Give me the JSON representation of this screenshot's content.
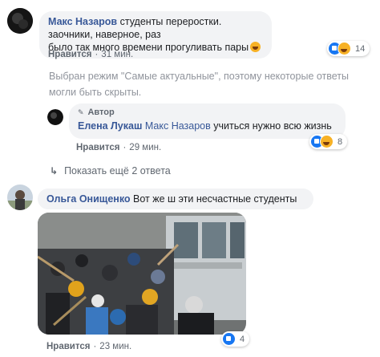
{
  "comments": [
    {
      "author": "Макс Назаров",
      "text_line1": "студенты переростки. заочники, наверное, раз",
      "text_line2": "было так много времени прогуливать пары",
      "like_label": "Нравится",
      "time": "31 мин.",
      "reaction_count": "14"
    },
    {
      "author": "Ольга Онищенко",
      "text": "Вот же ш эти несчастные студенты",
      "like_label": "Нравится",
      "time": "23 мин.",
      "reaction_count": "4"
    }
  ],
  "notice": {
    "line1": "Выбран режим \"Самые актуальные\", поэтому некоторые ответы",
    "line2": "могли быть скрыты."
  },
  "reply": {
    "badge": "Автор",
    "author": "Елена Лукаш",
    "mention": "Макс Назаров",
    "text": "учиться нужно всю жизнь",
    "like_label": "Нравится",
    "time": "29 мин.",
    "reaction_count": "8"
  },
  "show_more": {
    "label": "Показать ещё 2 ответа"
  },
  "colors": {
    "link": "#385898",
    "bubble": "#f2f3f5",
    "meta": "#606770",
    "like_reaction": "#1877f2",
    "haha_reaction": "#f7b125"
  }
}
